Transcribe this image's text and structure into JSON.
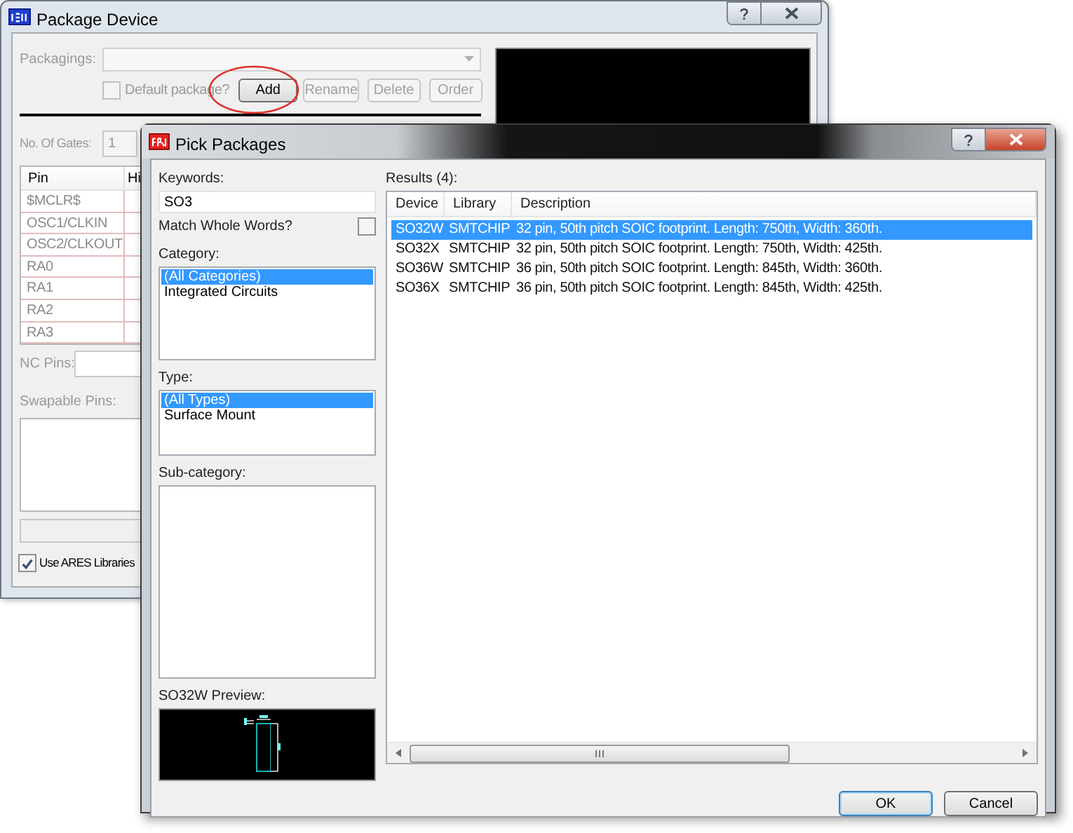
{
  "package_device": {
    "title": "Package Device",
    "packagings_label": "Packagings:",
    "default_package": {
      "label": "Default package?",
      "checked": false
    },
    "buttons": [
      {
        "label": "Add",
        "disabled": false
      },
      {
        "label": "Rename",
        "disabled": true
      },
      {
        "label": "Delete",
        "disabled": true
      },
      {
        "label": "Order",
        "disabled": true
      }
    ],
    "gates_label": "No. Of Gates:",
    "gates_value": "1",
    "pin_table": {
      "columns": [
        "Pin",
        "Hi"
      ],
      "rows": [
        "$MCLR$",
        "OSC1/CLKIN",
        "OSC2/CLKOUT",
        "RA0",
        "RA1",
        "RA2",
        "RA3"
      ]
    },
    "nc_pins_label": "NC Pins:",
    "swapable_pins_label": "Swapable Pins:",
    "use_ares": {
      "label": "Use ARES Libraries",
      "checked": true
    }
  },
  "pick_packages": {
    "title": "Pick Packages",
    "keywords_label": "Keywords:",
    "keywords_value": "SO3",
    "match_whole_words": {
      "label": "Match Whole Words?",
      "checked": false
    },
    "category_label": "Category:",
    "categories": [
      {
        "label": "(All Categories)",
        "selected": true
      },
      {
        "label": "Integrated Circuits",
        "selected": false
      }
    ],
    "type_label": "Type:",
    "types": [
      {
        "label": "(All Types)",
        "selected": true
      },
      {
        "label": "Surface Mount",
        "selected": false
      }
    ],
    "subcategory_label": "Sub-category:",
    "preview_label": "SO32W Preview:",
    "results_label": "Results (4):",
    "columns": [
      "Device",
      "Library",
      "Description"
    ],
    "rows": [
      {
        "cells": [
          "SO32W",
          "SMTCHIP",
          "32 pin, 50th pitch SOIC footprint. Length: 750th, Width: 360th."
        ],
        "selected": true
      },
      {
        "cells": [
          "SO32X",
          "SMTCHIP",
          "32 pin, 50th pitch SOIC footprint. Length: 750th, Width: 425th."
        ],
        "selected": false
      },
      {
        "cells": [
          "SO36W",
          "SMTCHIP",
          "36 pin, 50th pitch SOIC footprint. Length: 845th, Width: 360th."
        ],
        "selected": false
      },
      {
        "cells": [
          "SO36X",
          "SMTCHIP",
          "36 pin, 50th pitch SOIC footprint. Length: 845th, Width: 425th."
        ],
        "selected": false
      }
    ],
    "buttons": [
      "OK",
      "Cancel"
    ]
  }
}
